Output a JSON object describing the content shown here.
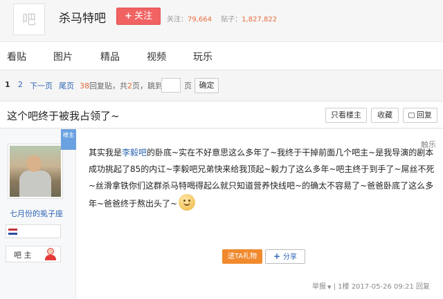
{
  "header": {
    "logo_text": "吧",
    "bar_name": "杀马特吧",
    "follow_label": "关注",
    "follow_plus": "+",
    "followers_label": "关注：",
    "followers_value": "79,664",
    "posts_label": "贴子：",
    "posts_value": "1,827,822"
  },
  "nav": {
    "items": [
      "看贴",
      "图片",
      "精品",
      "视频",
      "玩乐"
    ]
  },
  "pager": {
    "page1": "1",
    "page2": "2",
    "next": "下一页",
    "last": "尾页",
    "reply_count": "38",
    "reply_text": "回复贴，共",
    "total_pages": "2",
    "pages_suffix": "页，跳到",
    "page_unit": "页",
    "confirm": "确定"
  },
  "thread": {
    "title": "这个吧终于被我占领了~",
    "only_op": "只看楼主",
    "favorite": "收藏",
    "reply": "回复"
  },
  "post": {
    "ribbon": "楼主",
    "author_name": "七月份的虱子座",
    "role": "吧 主",
    "content_before_link": "其实我是",
    "content_link": "李毅吧",
    "content_after_link": "的卧底~实在不好意思这么多年了~我终于干掉前面几个吧主~是我导演的剧本成功挑起了85的内讧~李毅吧兄弟快来给我顶起~毅力了这么多年~吧主终于到手了~屌丝不死~丝滑拿铁你们这群杀马特喝得起么就只知道营养快线吧~的确太不容易了~爸爸卧底了这么多年~爸爸终于熬出头了~",
    "watermark": "触乐",
    "gift": "送TA礼物",
    "share": "分享",
    "share_plus": "+",
    "report": "举报",
    "report_arrow": "▼",
    "floor": "| 1楼",
    "datetime": "2017-05-26 09:21",
    "reply_link": "回复"
  }
}
